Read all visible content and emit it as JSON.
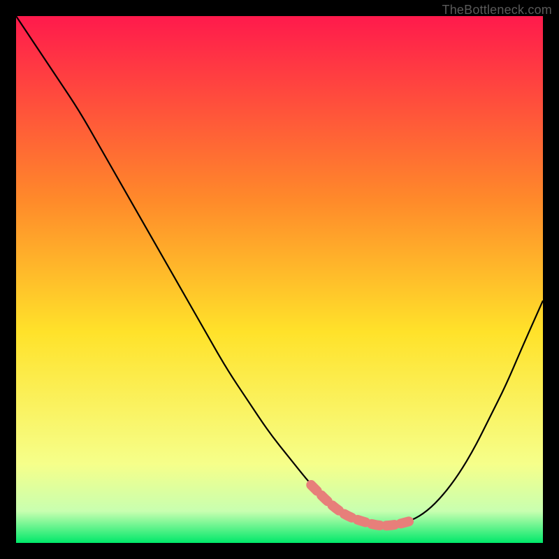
{
  "watermark": "TheBottleneck.com",
  "colors": {
    "black": "#000000",
    "curve": "#000000",
    "highlight": "#e77f7a",
    "grad_top": "#ff1a4c",
    "grad_mid1": "#ff8a2a",
    "grad_mid2": "#ffe22a",
    "grad_low1": "#f6ff8a",
    "grad_low2": "#c8ffb0",
    "grad_bot": "#00e86a"
  },
  "chart_data": {
    "type": "line",
    "title": "",
    "xlabel": "",
    "ylabel": "",
    "xlim": [
      0,
      100
    ],
    "ylim": [
      0,
      100
    ],
    "series": [
      {
        "name": "bottleneck-curve",
        "x": [
          0,
          4,
          8,
          12,
          16,
          20,
          24,
          28,
          32,
          36,
          40,
          44,
          48,
          52,
          56,
          60,
          63,
          66,
          69,
          72,
          75,
          78,
          81,
          84,
          87,
          90,
          93,
          96,
          100
        ],
        "y": [
          100,
          94,
          88,
          82,
          75,
          68,
          61,
          54,
          47,
          40,
          33,
          27,
          21,
          16,
          11,
          7,
          5,
          4,
          3.2,
          3.4,
          4.2,
          6,
          9,
          13,
          18,
          24,
          30,
          37,
          46
        ]
      }
    ],
    "highlight_segment": {
      "series": "bottleneck-curve",
      "x_from": 56,
      "x_to": 77,
      "label": "optimal-range"
    },
    "gradient_stops": [
      {
        "pct": 0,
        "color": "#ff1a4c"
      },
      {
        "pct": 35,
        "color": "#ff8a2a"
      },
      {
        "pct": 60,
        "color": "#ffe22a"
      },
      {
        "pct": 85,
        "color": "#f6ff8a"
      },
      {
        "pct": 94,
        "color": "#c8ffb0"
      },
      {
        "pct": 100,
        "color": "#00e86a"
      }
    ]
  }
}
